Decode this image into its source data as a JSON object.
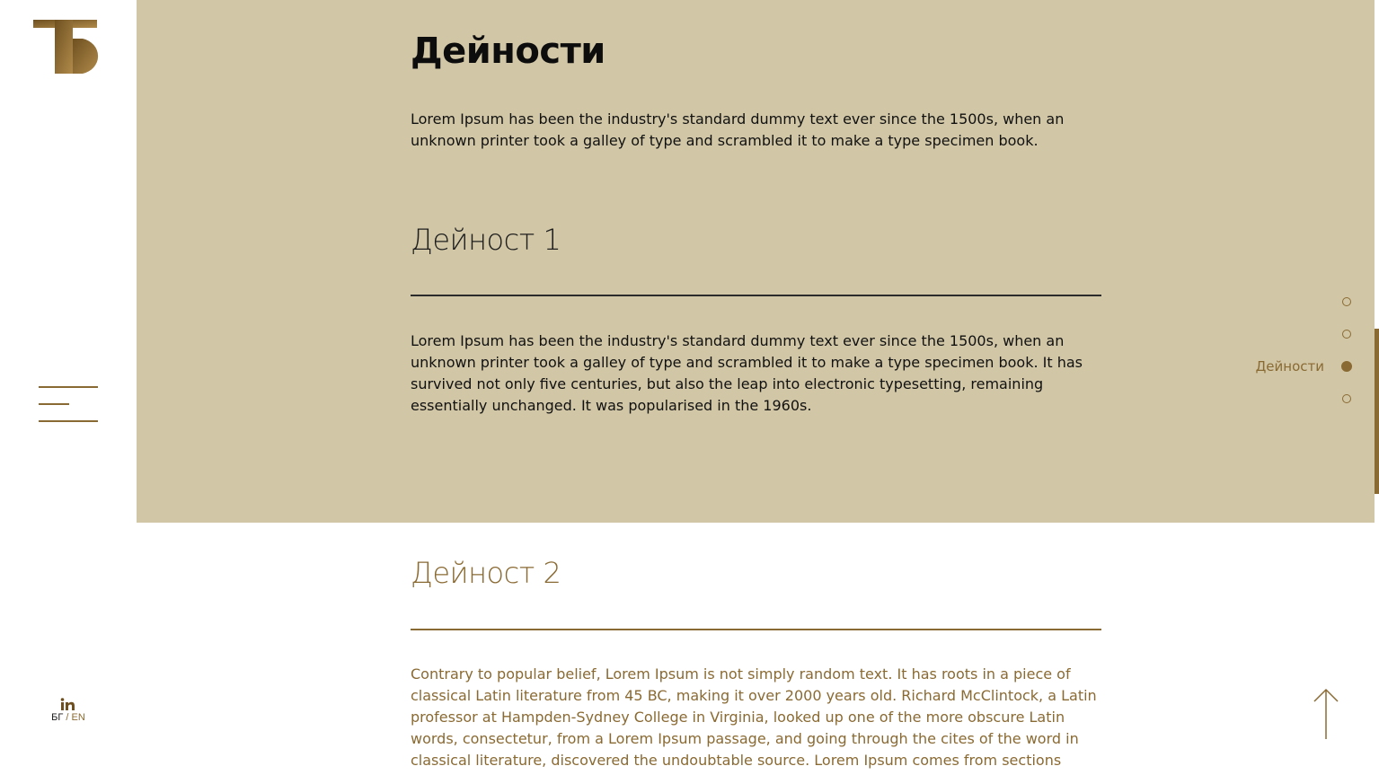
{
  "colors": {
    "accent": "#8a6a33",
    "band": "#d1c6a6",
    "text": "#111111"
  },
  "brand": {
    "logo_text": "ТБ"
  },
  "sidebar": {
    "menu_icon": "hamburger-menu-icon",
    "social_icon": "linkedin-icon",
    "social_label": "in",
    "lang": {
      "bg": "БГ",
      "sep": "/",
      "en": "EN"
    }
  },
  "page": {
    "title": "Дейности",
    "intro": "Lorem Ipsum has been the industry's standard dummy text ever since the 1500s, when an unknown printer took a galley of type and scrambled it to make a type specimen book."
  },
  "sections": [
    {
      "heading": "Дейност 1",
      "body": "Lorem Ipsum has been the industry's standard dummy text ever since the 1500s, when an unknown printer took a galley of type and scrambled it to make a type specimen book. It has survived not only five centuries, but also the leap into electronic typesetting, remaining essentially unchanged. It was popularised in the 1960s."
    },
    {
      "heading": "Дейност 2",
      "body": "Contrary to popular belief, Lorem Ipsum is not simply random text. It has roots in a piece of classical Latin literature from 45 BC, making it over 2000 years old. Richard McClintock, a Latin professor at Hampden-Sydney College in Virginia, looked up one of the more obscure Latin words, consectetur, from a Lorem Ipsum passage, and going through the cites of the word in classical literature, discovered the undoubtable source. Lorem Ipsum comes from sections"
    }
  ],
  "section_nav": {
    "active_index": 2,
    "active_label": "Дейности",
    "count": 4
  },
  "scroll_top_icon": "arrow-up-icon"
}
